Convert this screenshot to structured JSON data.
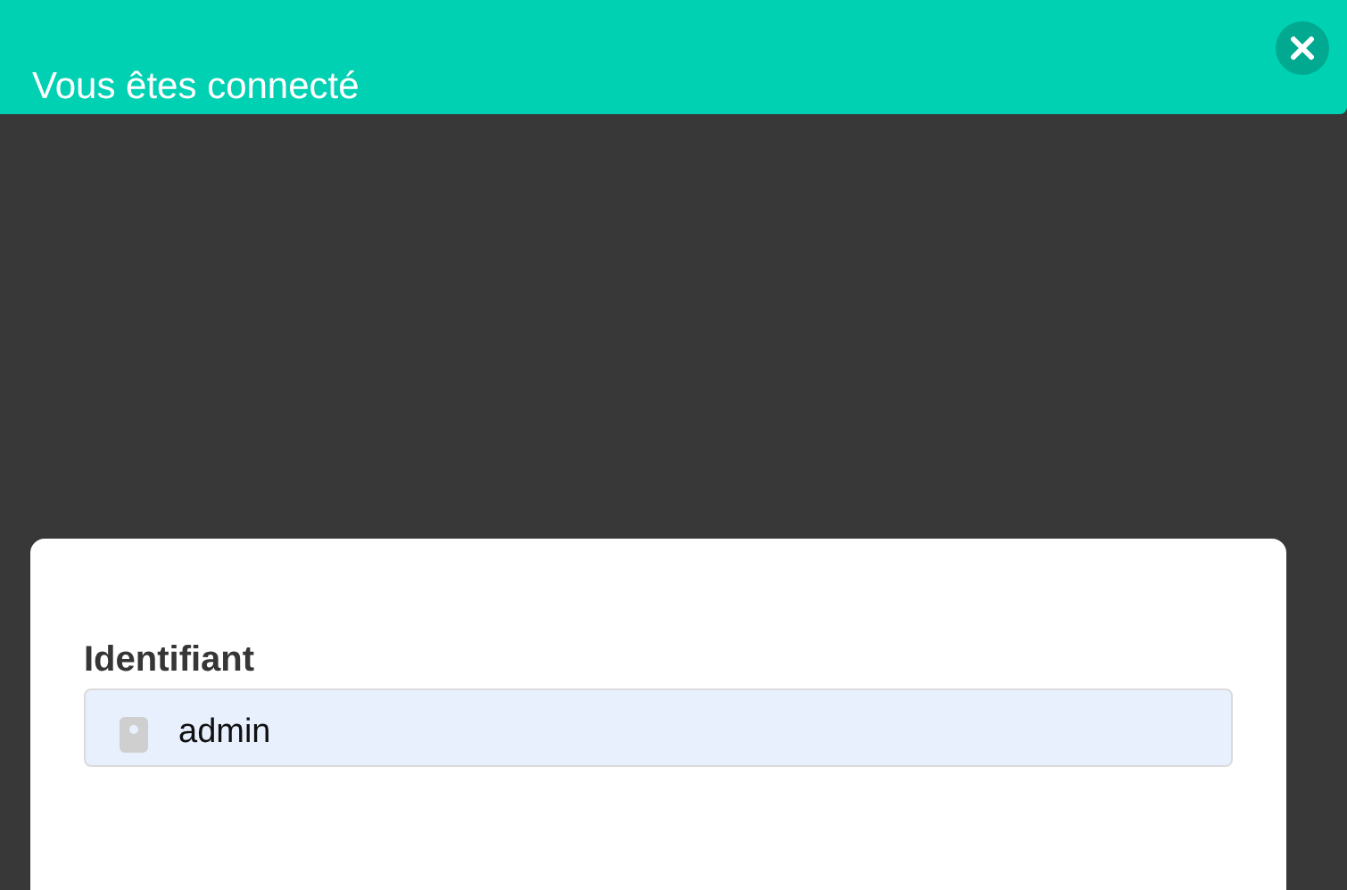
{
  "toast": {
    "message": "Vous êtes connecté"
  },
  "login_form": {
    "label": "Identifiant",
    "value": "admin"
  }
}
